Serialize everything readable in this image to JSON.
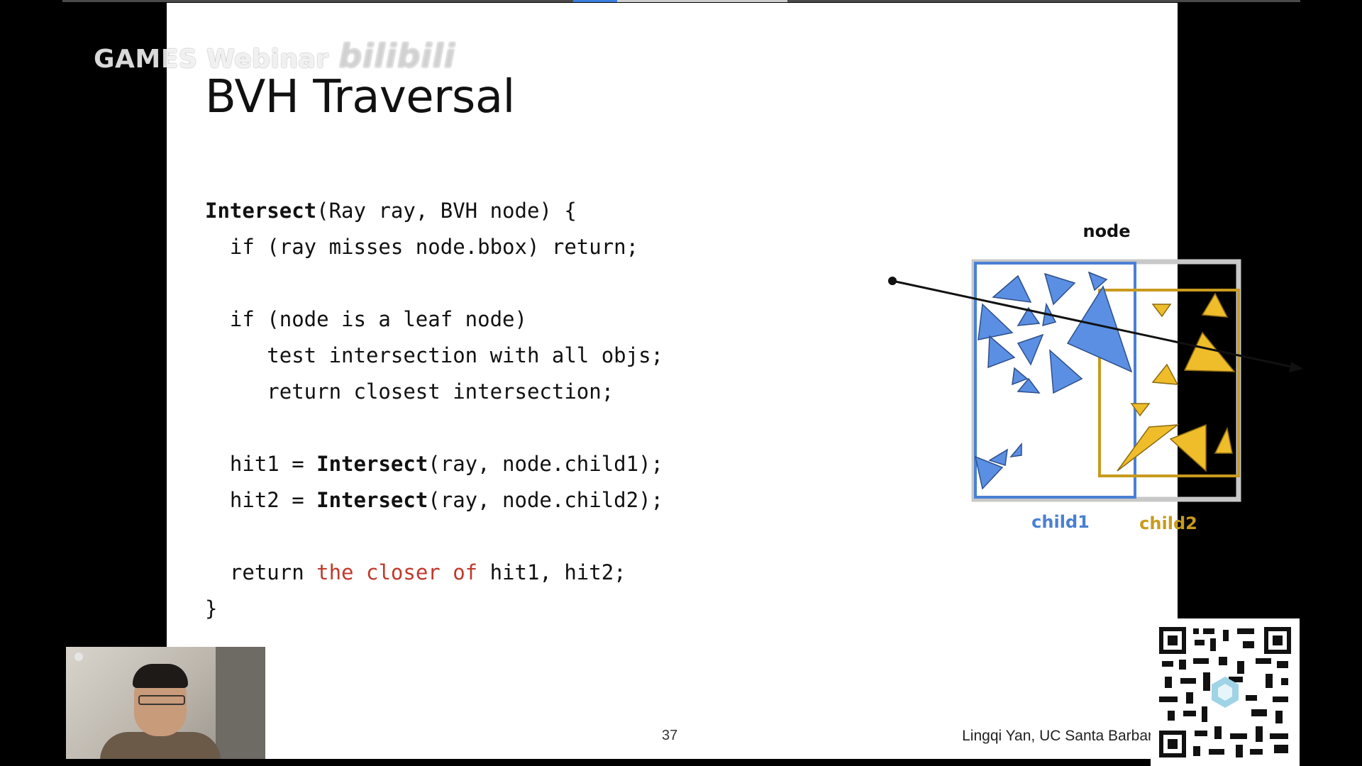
{
  "watermark": {
    "text": "GAMES Webinar",
    "brand": "bilibili"
  },
  "slide": {
    "title": "BVH Traversal",
    "code_lines": [
      "Intersect(Ray ray, BVH node) {",
      "  if (ray misses node.bbox) return;",
      "",
      "  if (node is a leaf node)",
      "     test intersection with all objs;",
      "     return closest intersection;",
      "",
      "  hit1 = Intersect(ray, node.child1);",
      "  hit2 = Intersect(ray, node.child2);",
      "",
      "  return the closer of hit1, hit2;",
      "}"
    ],
    "highlight_phrase": "the closer of",
    "diagram": {
      "node_label": "node",
      "child1_label": "child1",
      "child2_label": "child2",
      "colors": {
        "child1": "#4a80d4",
        "child2": "#c99a1e",
        "node_box": "#c8c8c8"
      }
    },
    "page_number": "37",
    "author": "Lingqi Yan, UC Santa Barbar"
  },
  "colors": {
    "highlight": "#c0392b",
    "progress": "#3d7fe0"
  }
}
